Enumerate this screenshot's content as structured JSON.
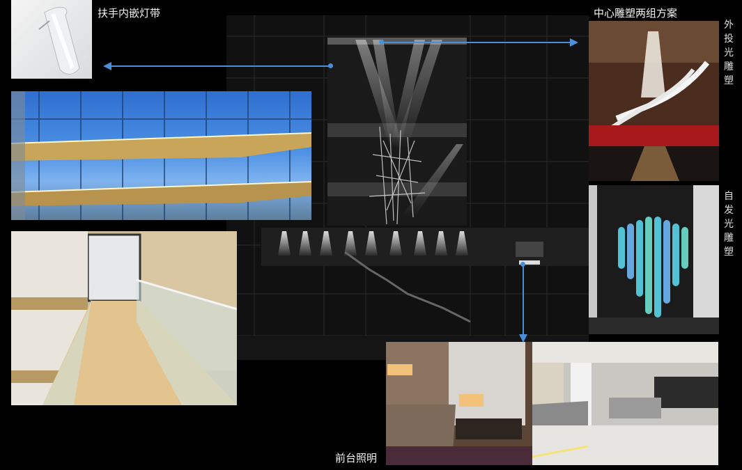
{
  "labels": {
    "handrail": "扶手内嵌灯带",
    "center_sculpture": "中心雕塑两组方案",
    "front_desk": "前台照明",
    "outer_projection": [
      "外",
      "投",
      "光",
      "雕",
      "塑"
    ],
    "self_luminous": [
      "自",
      "发",
      "光",
      "雕",
      "塑"
    ]
  },
  "colors": {
    "arrow": "#4a90d9",
    "background": "#000000"
  }
}
